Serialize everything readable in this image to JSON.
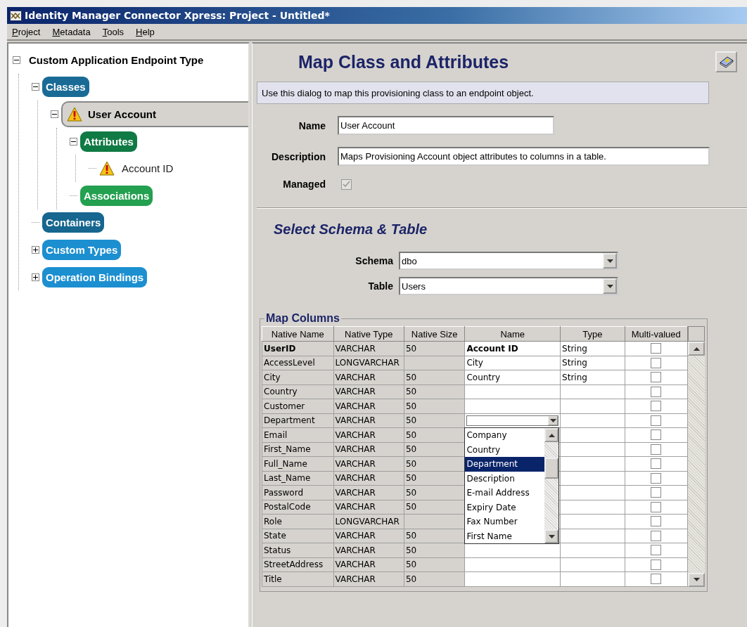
{
  "window": {
    "title": "Identity Manager Connector Xpress: Project - Untitled*"
  },
  "menu": [
    "Project",
    "Metadata",
    "Tools",
    "Help"
  ],
  "tree": [
    {
      "label": "Custom Application Endpoint Type",
      "kind": "heading",
      "selected": false,
      "expanded": true,
      "children": [
        {
          "label": "Classes",
          "kind": "pill",
          "color": "#1a6a96",
          "selected": false,
          "expanded": true,
          "children": [
            {
              "label": "User Account",
              "kind": "pill",
              "warning": true,
              "selected": true,
              "expanded": true,
              "children": [
                {
                  "label": "Attributes",
                  "kind": "pill",
                  "color": "#107a44",
                  "selected": false,
                  "expanded": true,
                  "children": [
                    {
                      "label": "Account ID",
                      "kind": "item",
                      "warning": true,
                      "selected": false
                    }
                  ]
                },
                {
                  "label": "Associations",
                  "kind": "pill",
                  "color": "#23a050",
                  "selected": false
                }
              ]
            }
          ]
        },
        {
          "label": "Containers",
          "kind": "pill",
          "color": "#16668f",
          "selected": false
        },
        {
          "label": "Custom Types",
          "kind": "pill",
          "color": "#1c8fd0",
          "selected": false,
          "expanded": false
        },
        {
          "label": "Operation Bindings",
          "kind": "pill",
          "color": "#1c8fd0",
          "selected": false,
          "expanded": false
        }
      ]
    }
  ],
  "page": {
    "title": "Map Class and Attributes",
    "info": "Use this dialog to map this provisioning class to an endpoint object.",
    "fields": [
      {
        "label": "Name",
        "value": "User Account",
        "kind": "short"
      },
      {
        "label": "Description",
        "value": "Maps Provisioning Account object attributes to columns in a table.",
        "kind": "long"
      }
    ],
    "managed": {
      "label": "Managed",
      "checked": true,
      "disabled": true
    },
    "section_title": "Select Schema & Table",
    "selects": [
      {
        "label": "Schema",
        "value": "dbo"
      },
      {
        "label": "Table",
        "value": "Users"
      }
    ]
  },
  "map_columns": {
    "title": "Map Columns",
    "columns": [
      "Native Name",
      "Native Type",
      "Native Size",
      "Name",
      "Type",
      "Multi-valued"
    ],
    "rows": [
      {
        "native_name": "UserID",
        "native_type": "VARCHAR",
        "native_size": "50",
        "name": "Account ID",
        "type": "String",
        "key": true,
        "multi_valued": false
      },
      {
        "native_name": "AccessLevel",
        "native_type": "LONGVARCHAR",
        "name": "City",
        "type": "String",
        "key": false,
        "multi_valued": false
      },
      {
        "native_name": "City",
        "native_type": "VARCHAR",
        "native_size": "50",
        "name": "Country",
        "type": "String",
        "key": false,
        "multi_valued": false
      },
      {
        "native_name": "Country",
        "native_type": "VARCHAR",
        "native_size": "50",
        "key": false,
        "multi_valued": false
      },
      {
        "native_name": "Customer",
        "native_type": "VARCHAR",
        "native_size": "50",
        "key": false,
        "multi_valued": false
      },
      {
        "native_name": "Department",
        "native_type": "VARCHAR",
        "native_size": "50",
        "key": false,
        "editing": true,
        "multi_valued": false
      },
      {
        "native_name": "Email",
        "native_type": "VARCHAR",
        "native_size": "50",
        "key": false,
        "multi_valued": false
      },
      {
        "native_name": "First_Name",
        "native_type": "VARCHAR",
        "native_size": "50",
        "key": false,
        "multi_valued": false
      },
      {
        "native_name": "Full_Name",
        "native_type": "VARCHAR",
        "native_size": "50",
        "key": false,
        "multi_valued": false
      },
      {
        "native_name": "Last_Name",
        "native_type": "VARCHAR",
        "native_size": "50",
        "key": false,
        "multi_valued": false
      },
      {
        "native_name": "Password",
        "native_type": "VARCHAR",
        "native_size": "50",
        "key": false,
        "multi_valued": false
      },
      {
        "native_name": "PostalCode",
        "native_type": "VARCHAR",
        "native_size": "50",
        "key": false,
        "multi_valued": false
      },
      {
        "native_name": "Role",
        "native_type": "LONGVARCHAR",
        "key": false,
        "multi_valued": false
      },
      {
        "native_name": "State",
        "native_type": "VARCHAR",
        "native_size": "50",
        "key": false,
        "multi_valued": false
      },
      {
        "native_name": "Status",
        "native_type": "VARCHAR",
        "native_size": "50",
        "key": false,
        "multi_valued": false
      },
      {
        "native_name": "StreetAddress",
        "native_type": "VARCHAR",
        "native_size": "50",
        "key": false,
        "multi_valued": false
      },
      {
        "native_name": "Title",
        "native_type": "VARCHAR",
        "native_size": "50",
        "key": false,
        "multi_valued": false
      }
    ],
    "dropdown": [
      {
        "label": "Company",
        "selected": false
      },
      {
        "label": "Country",
        "selected": false
      },
      {
        "label": "Department",
        "selected": true
      },
      {
        "label": "Description",
        "selected": false
      },
      {
        "label": "E-mail Address",
        "selected": false
      },
      {
        "label": "Expiry Date",
        "selected": false
      },
      {
        "label": "Fax Number",
        "selected": false
      },
      {
        "label": "First Name",
        "selected": false
      }
    ]
  }
}
